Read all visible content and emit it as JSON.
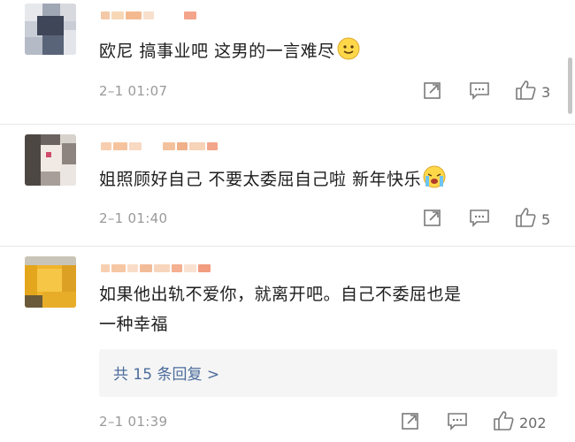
{
  "comments": [
    {
      "text": "欧尼 搞事业吧 这男的一言难尽",
      "emoji": "smile-emoji",
      "timestamp": "2–1 01:07",
      "likes": "3"
    },
    {
      "text": "姐照顾好自己 不要太委屈自己啦 新年快乐",
      "emoji": "crying-emoji",
      "timestamp": "2–1 01:40",
      "likes": "5"
    },
    {
      "text_line1": "如果他出轨不爱你，就离开吧。自己不委屈也是",
      "text_line2": "一种幸福",
      "replies_link": "共 15 条回复 >",
      "timestamp": "2–1 01:39",
      "likes": "202"
    }
  ],
  "icons": {
    "share": "share-icon",
    "reply": "comment-icon",
    "like": "thumbs-up-icon"
  },
  "colors": {
    "text": "#1e1e1e",
    "meta": "#9a9a9a",
    "link": "#4b6c9c",
    "reply_bg": "#f5f5f5",
    "divider": "#e9e9e9"
  }
}
